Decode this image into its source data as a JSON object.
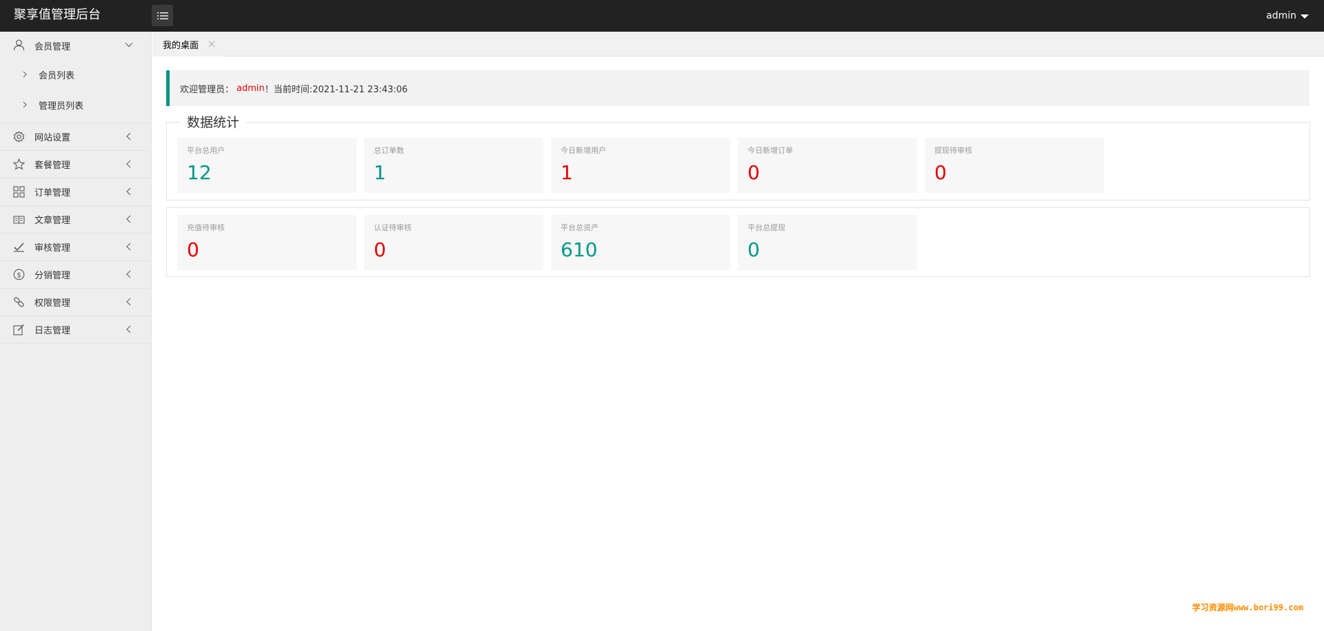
{
  "header": {
    "title": "聚享值管理后台",
    "user": "admin"
  },
  "sidebar": {
    "items": [
      {
        "label": "会员管理",
        "icon": "user-icon",
        "expanded": true,
        "children": [
          {
            "label": "会员列表"
          },
          {
            "label": "管理员列表"
          }
        ]
      },
      {
        "label": "网站设置",
        "icon": "gear-icon"
      },
      {
        "label": "套餐管理",
        "icon": "star-icon"
      },
      {
        "label": "订单管理",
        "icon": "grid-icon"
      },
      {
        "label": "文章管理",
        "icon": "book-icon"
      },
      {
        "label": "审核管理",
        "icon": "approve-icon"
      },
      {
        "label": "分销管理",
        "icon": "dollar-icon"
      },
      {
        "label": "权限管理",
        "icon": "link-icon"
      },
      {
        "label": "日志管理",
        "icon": "edit-icon"
      }
    ]
  },
  "tabs": [
    {
      "label": "我的桌面"
    }
  ],
  "welcome": {
    "prefix": "欢迎管理员：",
    "admin": "admin",
    "suffix": "！当前时间:2021-11-21 23:43:06"
  },
  "stats": {
    "title": "数据统计",
    "row1": [
      {
        "label": "平台总用户",
        "value": "12",
        "color": "#009688"
      },
      {
        "label": "总订单数",
        "value": "1",
        "color": "#009688"
      },
      {
        "label": "今日新增用户",
        "value": "1",
        "color": "#e60000"
      },
      {
        "label": "今日新增订单",
        "value": "0",
        "color": "#e60000"
      },
      {
        "label": "提现待审核",
        "value": "0",
        "color": "#e60000"
      }
    ],
    "row2": [
      {
        "label": "充值待审核",
        "value": "0",
        "color": "#e60000"
      },
      {
        "label": "认证待审核",
        "value": "0",
        "color": "#e60000"
      },
      {
        "label": "平台总资产",
        "value": "610",
        "color": "#009688"
      },
      {
        "label": "平台总提现",
        "value": "0",
        "color": "#009688"
      }
    ]
  },
  "watermark": "学习资源网www.bori99.com"
}
